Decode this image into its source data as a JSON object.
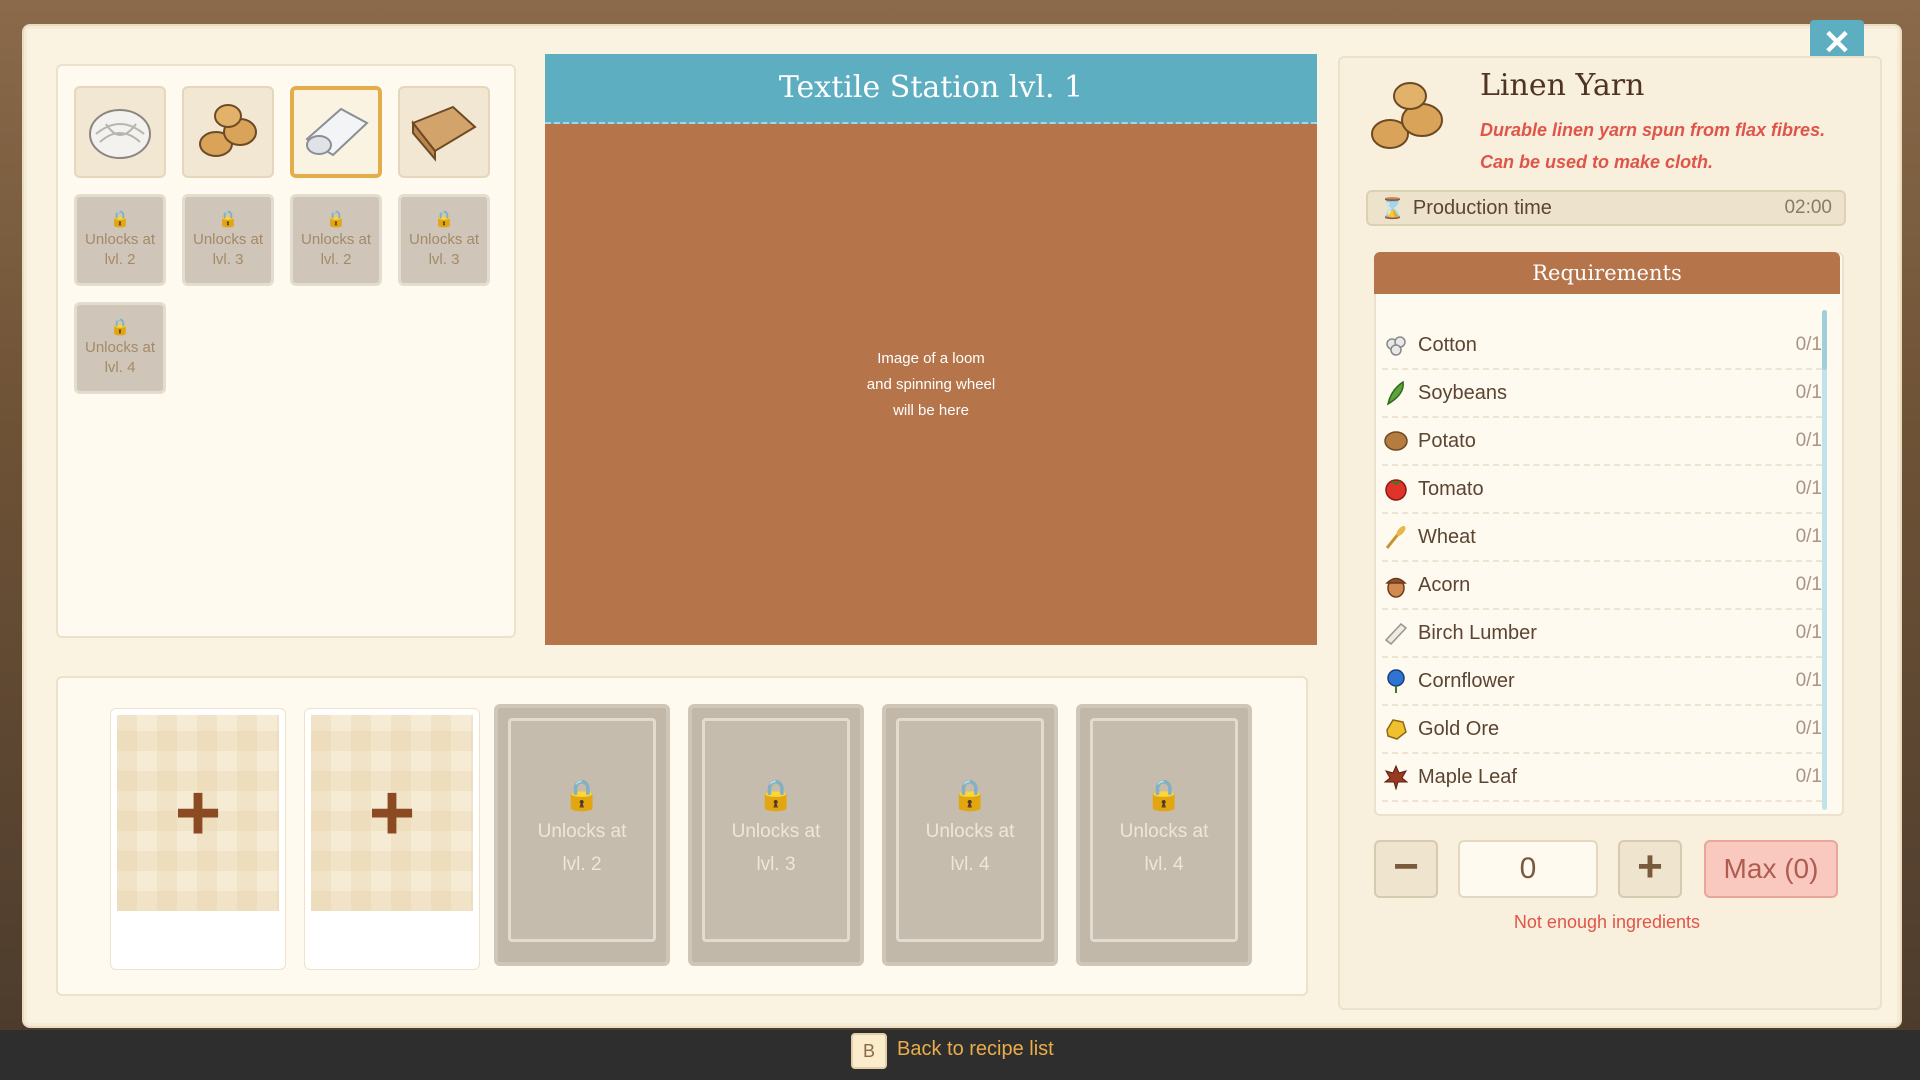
{
  "station": {
    "title": "Textile Station lvl. 1",
    "image_placeholder": "Image of a loom\nand spinning wheel\nwill be here"
  },
  "recipes": {
    "unlocked": [
      {
        "name": "cotton-thread",
        "icon": "cotton-bundle-icon"
      },
      {
        "name": "linen-yarn",
        "icon": "yarn-skein-icon",
        "selected": true
      },
      {
        "name": "cloth",
        "icon": "cloth-roll-icon"
      },
      {
        "name": "burlap",
        "icon": "burlap-sack-icon"
      }
    ],
    "locked": [
      {
        "label": "Unlocks at lvl. 2"
      },
      {
        "label": "Unlocks at lvl. 3"
      },
      {
        "label": "Unlocks at lvl. 2"
      },
      {
        "label": "Unlocks at lvl. 3"
      },
      {
        "label": "Unlocks at lvl. 4"
      }
    ]
  },
  "production_slots": {
    "open": [
      {
        "symbol": "+"
      },
      {
        "symbol": "+"
      }
    ],
    "locked": [
      {
        "line1": "Unlocks at",
        "line2": "lvl. 2"
      },
      {
        "line1": "Unlocks at",
        "line2": "lvl. 3"
      },
      {
        "line1": "Unlocks at",
        "line2": "lvl. 4"
      },
      {
        "line1": "Unlocks at",
        "line2": "lvl. 4"
      }
    ]
  },
  "item": {
    "name": "Linen Yarn",
    "description": "Durable linen yarn spun from flax fibres. Can be used to make cloth.",
    "production_time_label": "Production time",
    "production_time": "02:00"
  },
  "requirements": {
    "title": "Requirements",
    "items": [
      {
        "name": "Cotton",
        "count": "0/1",
        "icon": "cotton-icon",
        "color": "#e8e8e8"
      },
      {
        "name": "Soybeans",
        "count": "0/1",
        "icon": "soybean-icon",
        "color": "#5da33a"
      },
      {
        "name": "Potato",
        "count": "0/1",
        "icon": "potato-icon",
        "color": "#b47c3e"
      },
      {
        "name": "Tomato",
        "count": "0/1",
        "icon": "tomato-icon",
        "color": "#e0332a"
      },
      {
        "name": "Wheat",
        "count": "0/1",
        "icon": "wheat-icon",
        "color": "#e8b64a"
      },
      {
        "name": "Acorn",
        "count": "0/1",
        "icon": "acorn-icon",
        "color": "#b86a3a"
      },
      {
        "name": "Birch Lumber",
        "count": "0/1",
        "icon": "lumber-icon",
        "color": "#e2dcd4"
      },
      {
        "name": "Cornflower",
        "count": "0/1",
        "icon": "cornflower-icon",
        "color": "#2f74d2"
      },
      {
        "name": "Gold Ore",
        "count": "0/1",
        "icon": "gold-ore-icon",
        "color": "#f0c02e"
      },
      {
        "name": "Maple Leaf",
        "count": "0/1",
        "icon": "maple-leaf-icon",
        "color": "#9a3a22"
      }
    ]
  },
  "quantity": {
    "minus": "−",
    "value": "0",
    "plus": "+",
    "max_label": "Max (0)",
    "warning": "Not enough ingredients"
  },
  "footer": {
    "key": "B",
    "back_label": "Back to recipe list"
  },
  "close": {
    "symbol": "✕"
  },
  "colors": {
    "accent_teal": "#5eaec1",
    "accent_brown": "#b5744a",
    "warning_red": "#e0554a"
  }
}
